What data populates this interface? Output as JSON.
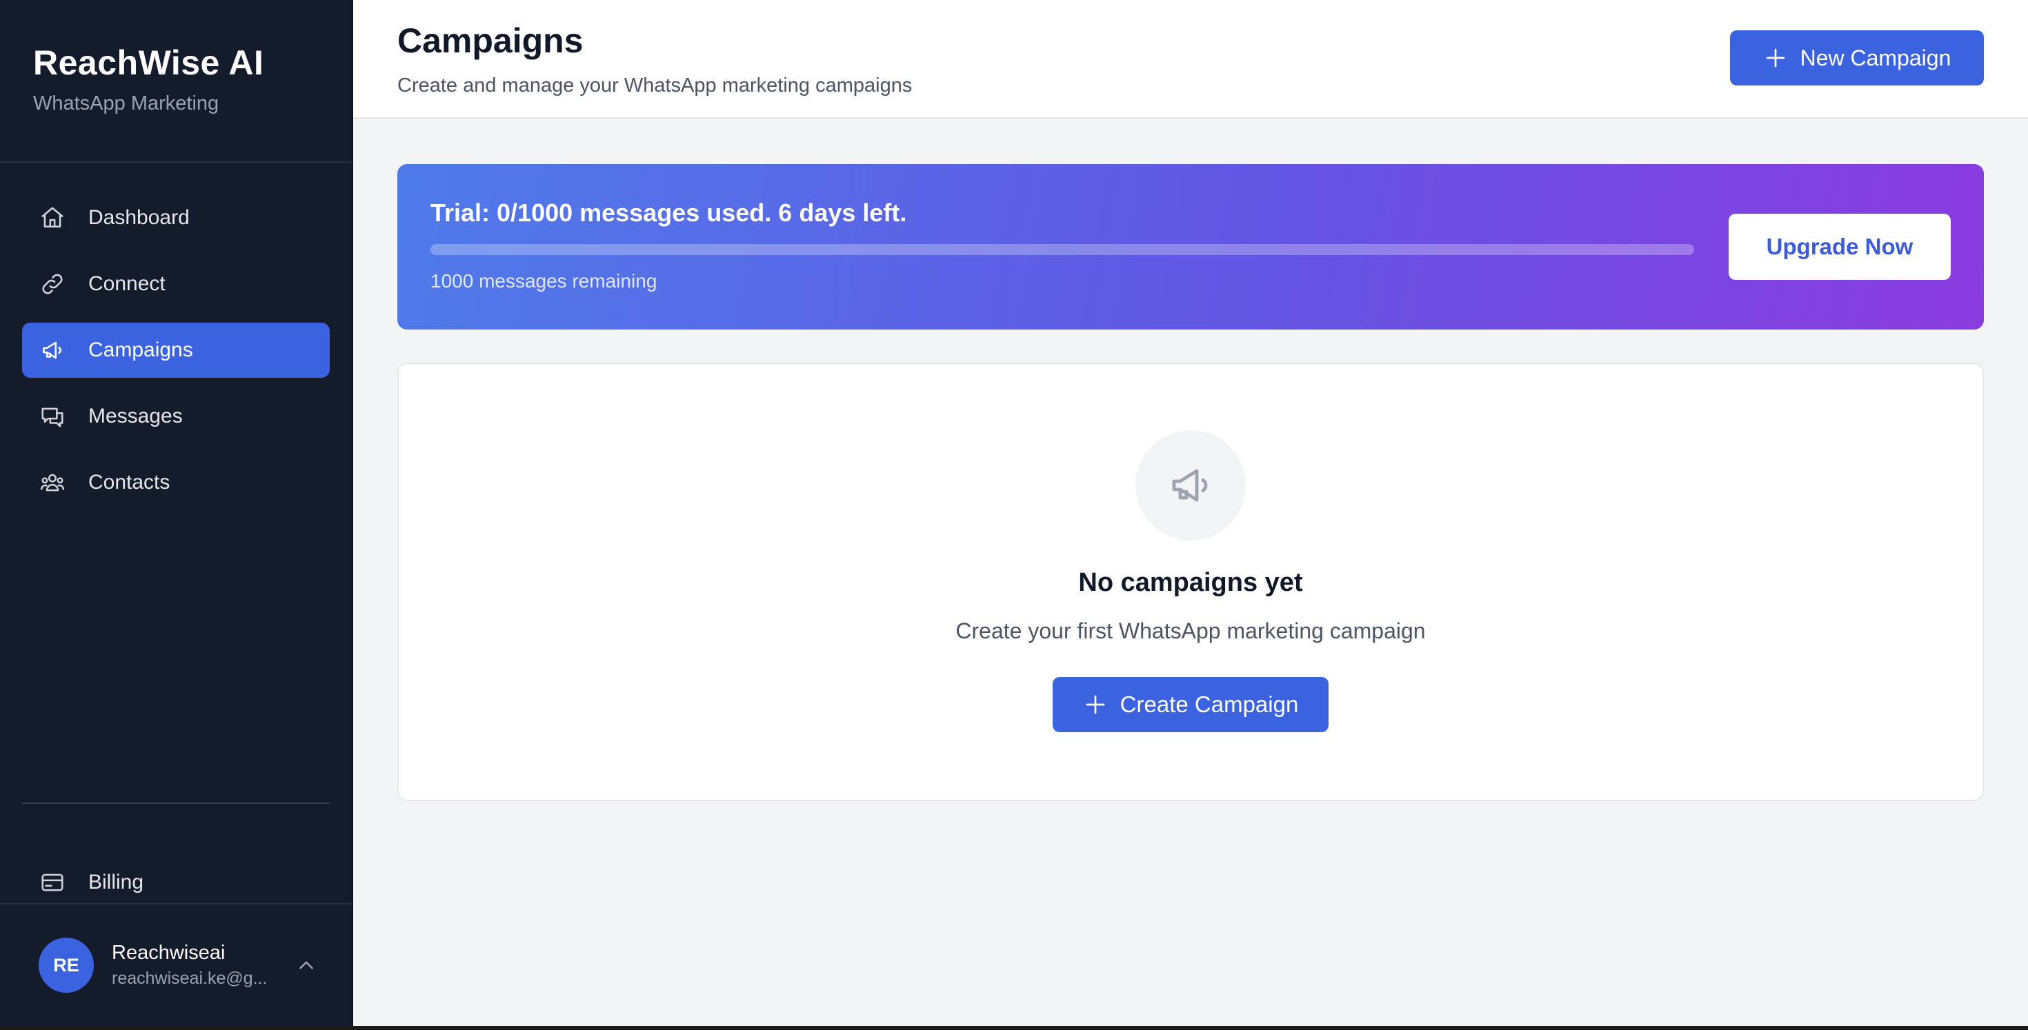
{
  "brand": {
    "title": "ReachWise AI",
    "subtitle": "WhatsApp Marketing"
  },
  "sidebar": {
    "items": [
      {
        "label": "Dashboard",
        "icon": "home-icon",
        "active": false
      },
      {
        "label": "Connect",
        "icon": "link-icon",
        "active": false
      },
      {
        "label": "Campaigns",
        "icon": "megaphone-icon",
        "active": true
      },
      {
        "label": "Messages",
        "icon": "chat-icon",
        "active": false
      },
      {
        "label": "Contacts",
        "icon": "users-icon",
        "active": false
      }
    ],
    "billing": {
      "label": "Billing",
      "icon": "credit-card-icon"
    }
  },
  "user": {
    "initials": "RE",
    "name": "Reachwiseai",
    "email": "reachwiseai.ke@g..."
  },
  "header": {
    "title": "Campaigns",
    "subtitle": "Create and manage your WhatsApp marketing campaigns",
    "new_button": "New Campaign"
  },
  "trial": {
    "title": "Trial: 0/1000 messages used. 6 days left.",
    "used_fraction": 0,
    "remaining": "1000 messages remaining",
    "upgrade_button": "Upgrade Now"
  },
  "empty_state": {
    "title": "No campaigns yet",
    "subtitle": "Create your first WhatsApp marketing campaign",
    "button": "Create Campaign"
  },
  "colors": {
    "accent": "#3b63e0",
    "sidebar_bg": "#141b2b",
    "banner_start": "#4f7bea",
    "banner_end": "#8b3be0"
  }
}
